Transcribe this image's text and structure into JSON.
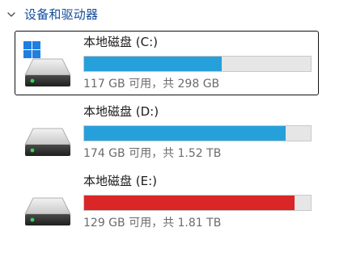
{
  "section": {
    "title": "设备和驱动器",
    "expanded": true
  },
  "colors": {
    "bar_normal": "#26a0da",
    "bar_full": "#da2626",
    "bar_track": "#e6e6e6",
    "accent": "#124c9a"
  },
  "drives": [
    {
      "name": "本地磁盘 (C:)",
      "space_text": "117 GB 可用，共 298 GB",
      "used_fraction": 0.607,
      "state": "normal",
      "is_system": true,
      "selected": true,
      "icon": "hard-drive-windows-icon"
    },
    {
      "name": "本地磁盘 (D:)",
      "space_text": "174 GB 可用，共 1.52 TB",
      "used_fraction": 0.888,
      "state": "normal",
      "is_system": false,
      "selected": false,
      "icon": "hard-drive-icon"
    },
    {
      "name": "本地磁盘 (E:)",
      "space_text": "129 GB 可用，共 1.81 TB",
      "used_fraction": 0.93,
      "state": "full",
      "is_system": false,
      "selected": false,
      "icon": "hard-drive-icon"
    }
  ]
}
